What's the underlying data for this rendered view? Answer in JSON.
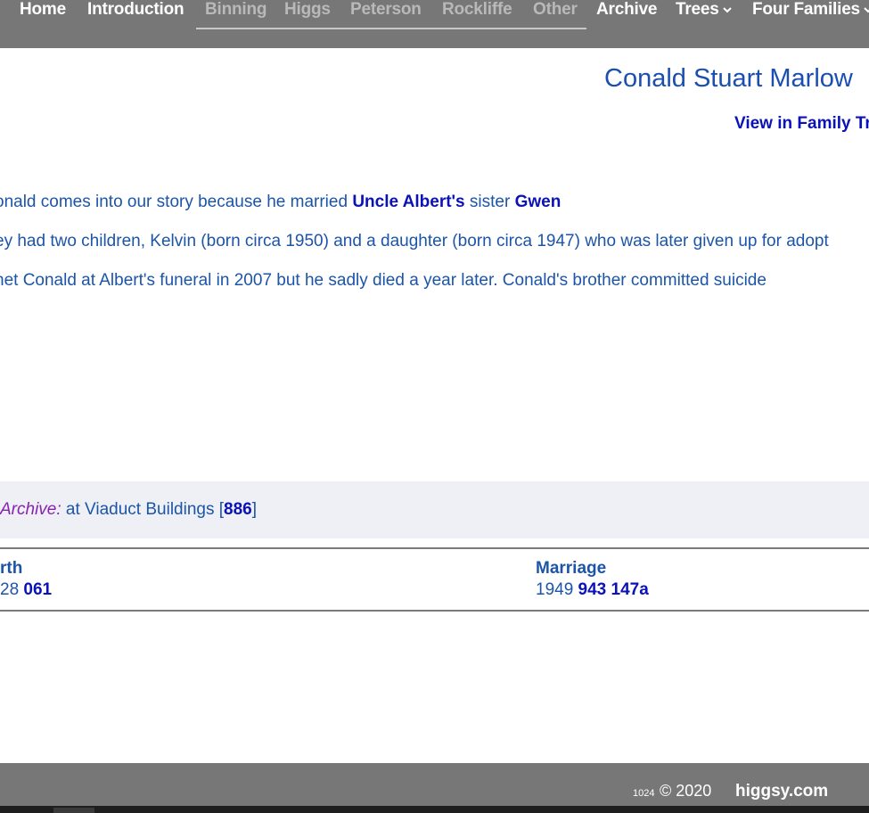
{
  "nav": {
    "items": [
      {
        "label": "Home",
        "dim": false
      },
      {
        "label": "Introduction",
        "dim": false
      },
      {
        "label": "Binning",
        "dim": true
      },
      {
        "label": "Higgs",
        "dim": true
      },
      {
        "label": "Peterson",
        "dim": true
      },
      {
        "label": "Rockliffe",
        "dim": true
      },
      {
        "label": "Other",
        "dim": true
      },
      {
        "label": "Archive",
        "dim": false
      },
      {
        "label": "Trees",
        "dim": false
      },
      {
        "label": "Four Families",
        "dim": false
      }
    ]
  },
  "page": {
    "title": "Conald Stuart Marlow",
    "tree_link": "View in Family Tr"
  },
  "story": {
    "p1": {
      "before": "onald comes into our story because he married ",
      "link1": "Uncle Albert's",
      "middle": " sister ",
      "link2": "Gwen"
    },
    "p2": "ey had two children, Kelvin (born circa 1950) and a daughter (born circa 1947) who was later given up for adopt",
    "p3": "net Conald at Albert's funeral in 2007 but he sadly died a year later. Conald's brother committed suicide"
  },
  "archive": {
    "label": "Archive:",
    "text": " at Viaduct Buildings [",
    "number": "886",
    "close": "]"
  },
  "records": {
    "birth": {
      "heading": "rth",
      "year": "28 ",
      "ref": "061"
    },
    "marriage": {
      "heading": "Marriage",
      "year": "1949 ",
      "ref": "943 147a"
    }
  },
  "footer": {
    "small": "1024",
    "copyright": "© 2020",
    "site": "higgsy.com"
  },
  "colors": {
    "nav_bg": "#777777",
    "link": "#0b12b6",
    "text": "#1c55a8",
    "archive_label": "#8a22b0"
  }
}
